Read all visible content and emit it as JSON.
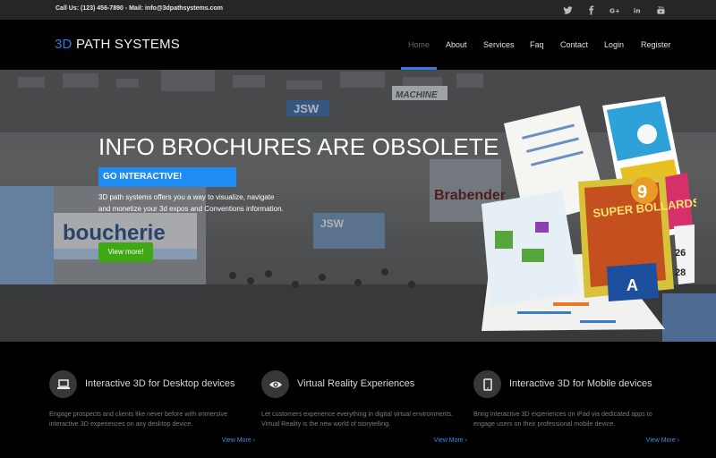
{
  "topbar": {
    "contact": "Call Us: (123) 456-7890 - Mail: info@3dpathsystems.com",
    "social": [
      {
        "icon": "twitter-icon"
      },
      {
        "icon": "facebook-icon"
      },
      {
        "icon": "google-plus-icon"
      },
      {
        "icon": "linkedin-icon"
      },
      {
        "icon": "youtube-icon"
      }
    ]
  },
  "logo": {
    "accent": "3D",
    "rest": " PATH SYSTEMS",
    "accent_color": "#2f7de0"
  },
  "nav": [
    {
      "label": "Home",
      "active": true
    },
    {
      "label": "About"
    },
    {
      "label": "Services"
    },
    {
      "label": "Faq"
    },
    {
      "label": "Contact"
    },
    {
      "label": "Login"
    },
    {
      "label": "Register"
    }
  ],
  "hero": {
    "title": "INFO BROCHURES ARE OBSOLETE",
    "cta_primary": "GO INTERACTIVE!",
    "desc_line1": "3D path systems offers you a way to visualize, navigate",
    "desc_line2": "and monetize your 3d expos and Conventions information.",
    "cta_secondary": "View more!",
    "booth_signs": [
      "boucherie",
      "JSW",
      "MACHINE",
      "Brabender",
      "JSW"
    ],
    "brochure_text": [
      "SUPER BOLLARDS EXPO",
      "9",
      "26",
      "28"
    ]
  },
  "features": [
    {
      "icon": "laptop-icon",
      "title": "Interactive 3D for Desktop devices",
      "text": "Engage prospects and clients like never before with immersive interactive 3D experiences on any desktop device.",
      "link": "View More ›"
    },
    {
      "icon": "eye-icon",
      "title": "Virtual Reality Experiences",
      "text": "Let customers experience everything in digital virtual environments. Virtual Reality is the new world of storytelling.",
      "link": "View More ›"
    },
    {
      "icon": "tablet-icon",
      "title": "Interactive 3D for Mobile devices",
      "text": "Bring interactive 3D experiences on iPad via dedicated apps to engage users on their professional mobile device.",
      "link": "View More ›"
    }
  ],
  "colors": {
    "accent": "#1e8cf2",
    "green": "#3fa814",
    "topbar": "#262626"
  }
}
